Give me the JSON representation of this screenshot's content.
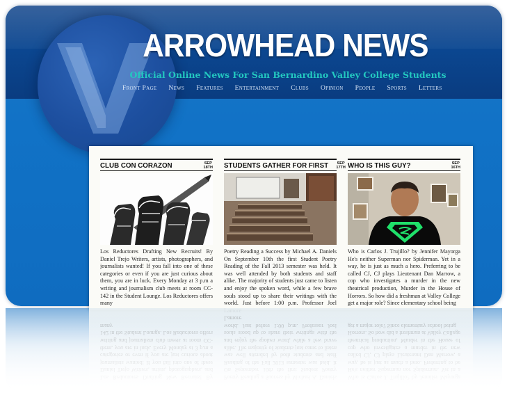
{
  "site": {
    "title": "ARROWHEAD NEWS",
    "tagline": "Official Online News For San Bernardino Valley College Students"
  },
  "nav": [
    {
      "label": "Front Page"
    },
    {
      "label": "News"
    },
    {
      "label": "Features"
    },
    {
      "label": "Entertainment"
    },
    {
      "label": "Clubs"
    },
    {
      "label": "Opinion"
    },
    {
      "label": "People"
    },
    {
      "label": "Sports"
    },
    {
      "label": "Letters"
    }
  ],
  "articles": [
    {
      "title": "CLUB CON CORAZON",
      "date_month": "SEP",
      "date_day": "18TH",
      "image_icon": "raised-fists-pencil-illustration",
      "text": "Los Reductores Drafting New Recruits! By Daniel Trejo Writers, artists, photographers, and journalists wanted! If you fall into one of these categories or even if you are just curious about them, you are in luck. Every Monday at 3 p.m a writing and journalism club meets at room CC-142 in the Student Lounge. Los Reductores offers many"
    },
    {
      "title": "STUDENTS GATHER FOR FIRST",
      "date_month": "SEP",
      "date_day": "17TH",
      "image_icon": "lecture-hall-photo",
      "text": "Poetry Reading a Success by Michael A. Daniels On September 10th the first Student Poetry Reading of the Fall 2013 semester was held. It was well attended by both students and staff alike. The majority of students just came to listen and enjoy the spoken word, while a few brave souls stood up to share their writings with the world. Just before 1:00 p.m. Professor Joel Lamore"
    },
    {
      "title": "WHO IS THIS GUY?",
      "date_month": "SEP",
      "date_day": "16TH",
      "image_icon": "student-superman-shirt-photo",
      "text": "Who is Carlos J. Trujillo? by Jennifer Mayorga He's neither Superman nor Spiderman. Yet in a way, he is just as much a hero. Preferring to be called CJ, CJ plays Lieutenant Dan Marrow, a cop who investigates a murder in the new theatrical production, Murder in the House of Horrors. So how did a freshman at Valley College get a major role? Since elementary school being"
    }
  ],
  "colors": {
    "background_blue": "#1172c6",
    "header_navy": "#0a3f87",
    "tagline_teal": "#23c8c0",
    "title_white": "#ffffff",
    "superman_green": "#1fe06a"
  }
}
